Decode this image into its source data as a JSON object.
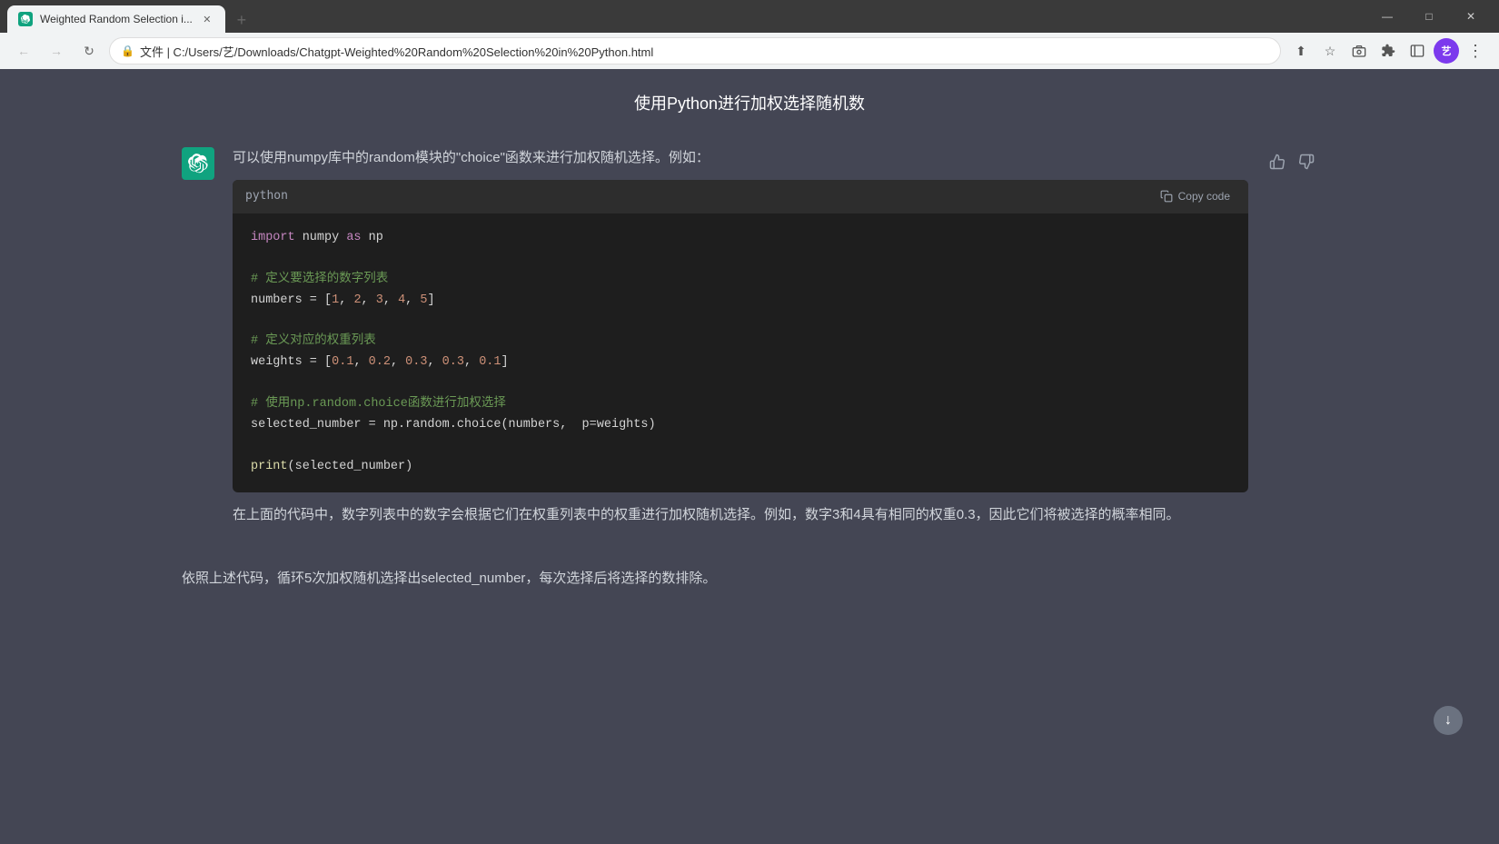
{
  "browser": {
    "tab_title": "Weighted Random Selection i...",
    "tab_favicon_alt": "chatgpt-icon",
    "address": "文件 | C:/Users/艺/Downloads/Chatgpt-Weighted%20Random%20Selection%20in%20Python.html",
    "new_tab_label": "+",
    "window_controls": {
      "minimize": "—",
      "maximize": "□",
      "close": "✕"
    },
    "nav": {
      "back": "←",
      "forward": "→",
      "refresh": "↻",
      "share": "⬆",
      "star": "☆",
      "extensions_icon": "🧩",
      "puzzle": "⊞",
      "sidebar": "▭",
      "avatar_text": "艺",
      "menu": "⋮"
    }
  },
  "page": {
    "header": "使用Python进行加权选择随机数",
    "message": {
      "intro": "可以使用numpy库中的random模块的\"choice\"函数来进行加权随机选择。例如：",
      "code_lang": "python",
      "copy_label": "Copy code",
      "code_lines": [
        {
          "type": "import",
          "text": "import numpy as np"
        },
        {
          "type": "blank"
        },
        {
          "type": "comment",
          "text": "# 定义要选择的数字列表"
        },
        {
          "type": "code",
          "text": "numbers = [1, 2, 3, 4, 5]"
        },
        {
          "type": "blank"
        },
        {
          "type": "comment",
          "text": "# 定义对应的权重列表"
        },
        {
          "type": "code",
          "text": "weights = [0.1, 0.2, 0.3, 0.3, 0.1]"
        },
        {
          "type": "blank"
        },
        {
          "type": "comment",
          "text": "# 使用np.random.choice函数进行加权选择"
        },
        {
          "type": "code",
          "text": "selected_number = np.random.choice(numbers,  p=weights)"
        },
        {
          "type": "blank"
        },
        {
          "type": "code_print",
          "text": "print(selected_number)"
        }
      ],
      "explanation": "在上面的代码中，数字列表中的数字会根据它们在权重列表中的权重进行加权随机选择。例如，数字3和4具有相同的权重0.3，因此它们将被选择的概率相同。",
      "bottom_text": "依照上述代码，循环5次加权随机选择出selected_number，每次选择后将选择的数排除。"
    }
  }
}
